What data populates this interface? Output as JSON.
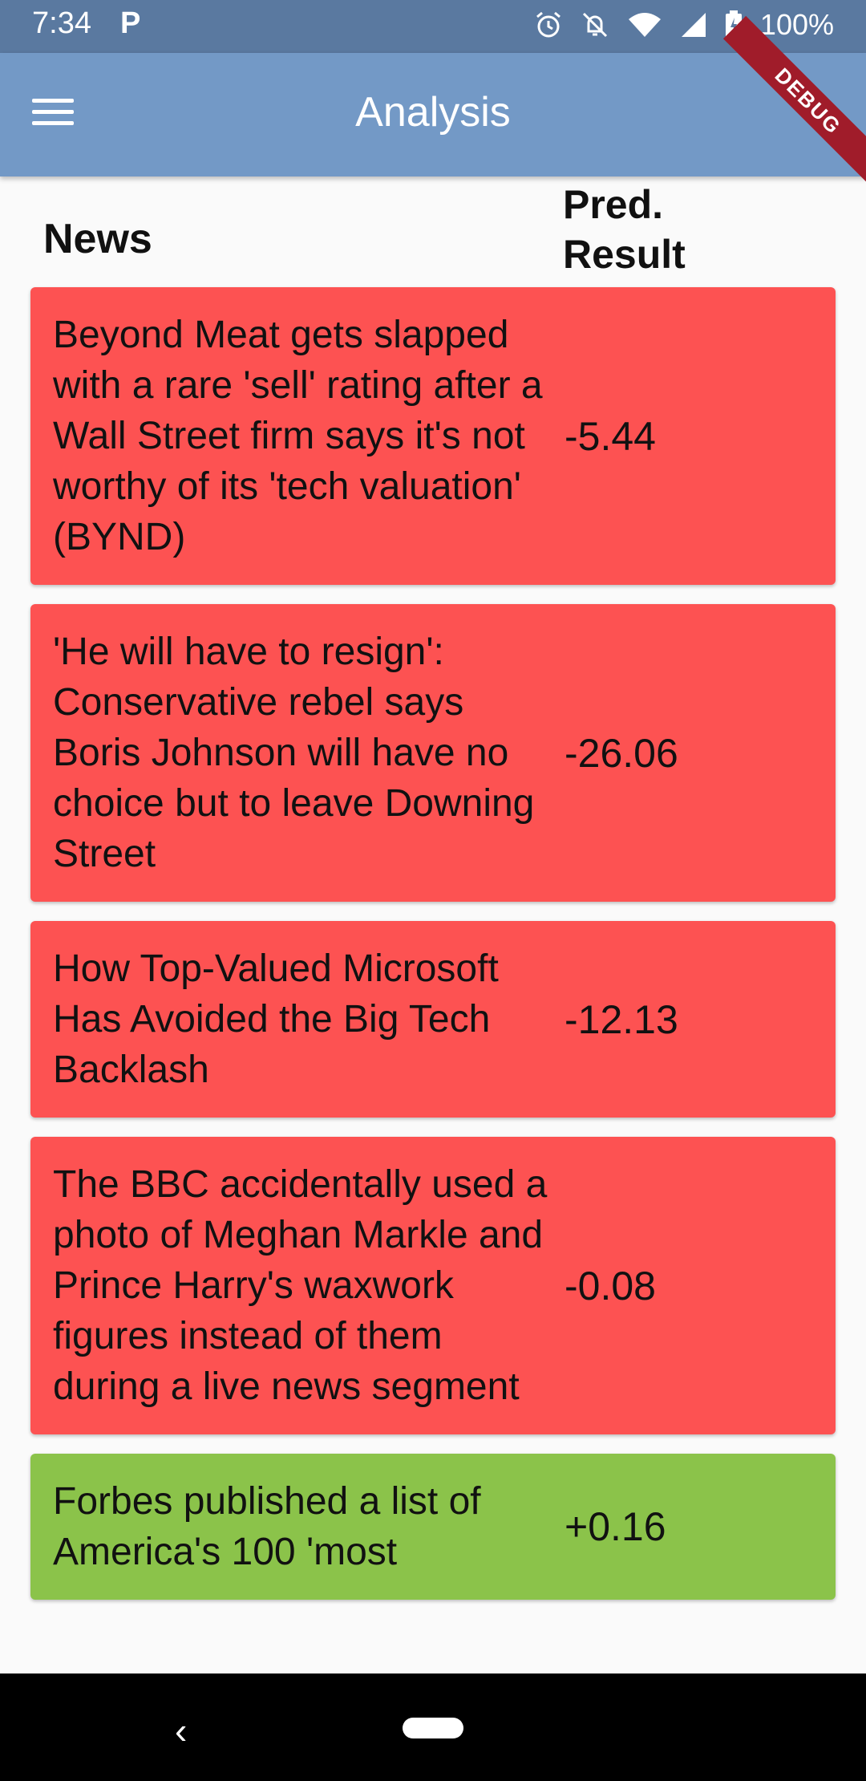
{
  "status_bar": {
    "time": "7:34",
    "app_icon_letter": "P",
    "battery": "100%"
  },
  "app_bar": {
    "title": "Analysis",
    "debug_label": "DEBUG"
  },
  "columns": {
    "news": "News",
    "pred_line1": "Pred.",
    "pred_line2": "Result"
  },
  "items": [
    {
      "text": "Beyond Meat gets slapped with a rare 'sell' rating after a Wall Street firm says it's not worthy of its 'tech valuation' (BYND)",
      "score": "-5.44",
      "sentiment": "negative"
    },
    {
      "text": "'He will have to resign': Conservative rebel says Boris Johnson will have no choice but to leave Downing Street",
      "score": "-26.06",
      "sentiment": "negative"
    },
    {
      "text": "How Top-Valued Microsoft Has Avoided the Big Tech Backlash",
      "score": "-12.13",
      "sentiment": "negative"
    },
    {
      "text": "The BBC accidentally used a photo of Meghan Markle and Prince Harry's waxwork figures instead of them during a live news segment",
      "score": "-0.08",
      "sentiment": "negative"
    },
    {
      "text": "Forbes published a list of America's 100 'most",
      "score": "+0.16",
      "sentiment": "positive"
    }
  ],
  "colors": {
    "negative": "#fd5252",
    "positive": "#8bc34a",
    "app_bar": "#7399c6",
    "status_bar": "#5a79a0"
  }
}
